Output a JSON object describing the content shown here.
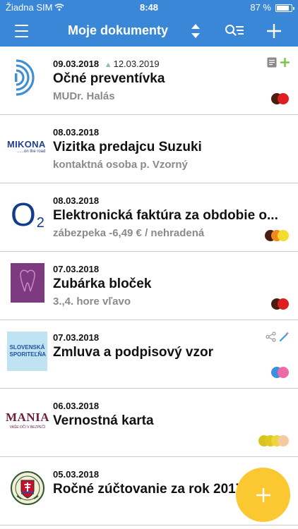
{
  "status_bar": {
    "carrier": "Žiadna SIM",
    "wifi_icon": "wifi-icon",
    "time": "8:48",
    "battery_text": "87 %",
    "battery_level": 0.87
  },
  "nav": {
    "title": "Moje dokumenty",
    "menu_icon": "hamburger-menu-icon",
    "sort_icon": "sort-updown-icon",
    "search_icon": "search-filter-icon",
    "add_icon": "plus-icon"
  },
  "documents": [
    {
      "date": "09.03.2018",
      "reminder": "12.03.2019",
      "title": "Očné preventívka",
      "subtitle": "MUDr. Halás",
      "thumbnail": "eye-clinic-logo",
      "icons": [
        "note-icon",
        "plus-green-icon"
      ],
      "tag_colors": [
        "#dd1f1f",
        "#4a1c12"
      ]
    },
    {
      "date": "08.03.2018",
      "title": "Vizitka predajcu Suzuki",
      "subtitle": "kontaktná osoba p. Vzorný",
      "thumbnail": "mikona-logo",
      "thumbnail_text": "MIKONA",
      "thumbnail_subtext": "......on the road",
      "icons": [],
      "tag_colors": []
    },
    {
      "date": "08.03.2018",
      "title": "Elektronická faktúra za obdobie o...",
      "subtitle": "zábezpeka -6,49 € / nehradená",
      "thumbnail": "o2-logo",
      "thumbnail_text": "O",
      "thumbnail_subtext": "2",
      "icons": [],
      "tag_colors": [
        "#f3dc2b",
        "#f08a1c",
        "#4a1c12"
      ]
    },
    {
      "date": "07.03.2018",
      "title": "Zubárka bloček",
      "subtitle": "3.,4. hore vľavo",
      "thumbnail": "dental-clinic-logo",
      "icons": [],
      "tag_colors": [
        "#dd1f1f",
        "#4a1c12"
      ]
    },
    {
      "date": "07.03.2018",
      "title": "Zmluva a podpisový vzor",
      "subtitle": "",
      "thumbnail": "slovenska-sporitelna-logo",
      "thumbnail_text": "SLOVENSKÁ SPORITEĽŇA",
      "icons": [
        "share-icon",
        "magic-wand-icon"
      ],
      "tag_colors": [
        "#f06aa8",
        "#3d8fe0"
      ]
    },
    {
      "date": "06.03.2018",
      "title": "Vernostná karta",
      "subtitle": "",
      "thumbnail": "mania-logo",
      "thumbnail_text": "MANIA",
      "thumbnail_subtext": "VAŠE OČI V BEZPEČÍ",
      "icons": [],
      "tag_colors": [
        "#f4caa0",
        "#f0d43a",
        "#e0c820",
        "#d9c41d"
      ]
    },
    {
      "date": "05.03.2018",
      "title": "Ročné zúčtovanie za rok 2017",
      "subtitle": "",
      "thumbnail": "financial-authority-emblem",
      "icons": [],
      "tag_colors": []
    }
  ],
  "fab": {
    "icon": "plus-icon",
    "color": "#fbc832"
  },
  "colors": {
    "header": "#3a87d8",
    "divider": "#c9c9c9",
    "subtitle": "#8a8a8a"
  }
}
